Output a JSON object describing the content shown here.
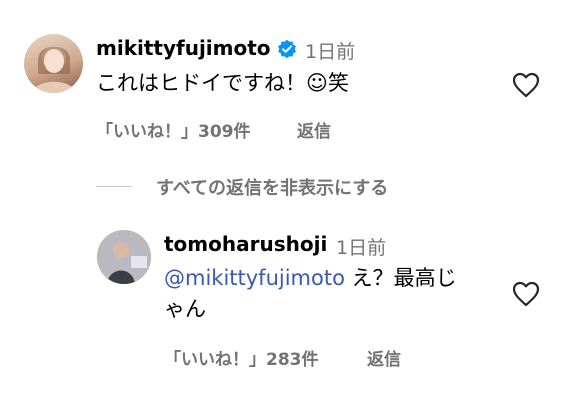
{
  "comments": [
    {
      "username": "mikittyfujimoto",
      "verified": true,
      "time": "1日前",
      "text": "これはヒドイですね！☺笑",
      "likes_label": "「いいね！」309件",
      "reply_label": "返信"
    }
  ],
  "hide_replies_label": "すべての返信を非表示にする",
  "replies": [
    {
      "username": "tomoharushoji",
      "time": "1日前",
      "mention": "@mikittyfujimoto",
      "text_line1": " え？最高じ",
      "text_line2": "ゃん",
      "likes_label": "「いいね！」283件",
      "reply_label": "返信"
    }
  ],
  "colors": {
    "verified": "#0095f6",
    "mention": "#3a5aa8",
    "muted": "#737373"
  },
  "icons": {
    "like": "heart-outline-icon",
    "badge": "verified-badge-icon"
  }
}
